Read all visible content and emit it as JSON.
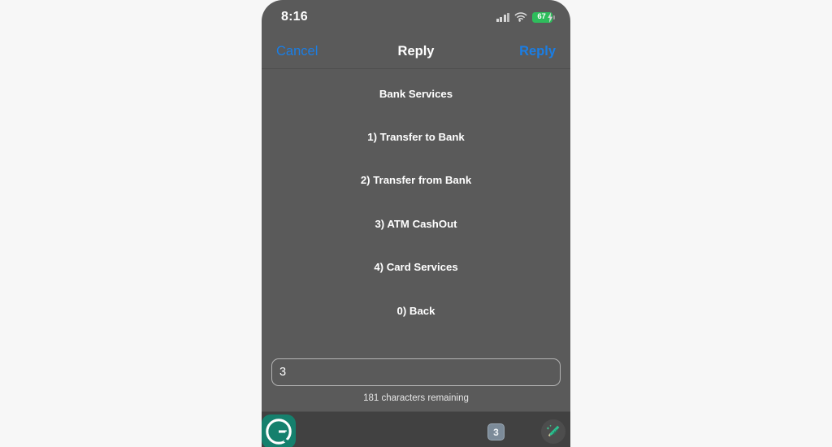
{
  "status_bar": {
    "time": "8:16",
    "signal_icon": "cellular-signal-icon",
    "wifi_icon": "wifi-icon",
    "battery_percent": "67",
    "battery_charging_icon": "charging-bolt-icon"
  },
  "nav_bar": {
    "cancel_label": "Cancel",
    "title": "Reply",
    "reply_label": "Reply"
  },
  "message": {
    "lines": [
      "Bank Services",
      "1) Transfer to Bank",
      "2) Transfer from Bank",
      "3) ATM CashOut",
      "4) Card Services",
      "0) Back"
    ]
  },
  "composer": {
    "input_value": "3",
    "input_placeholder": "",
    "char_count": "181 characters remaining"
  },
  "keyboard_bar": {
    "grammarly_logo_icon": "grammarly-logo-icon",
    "suggestion_badge": "3",
    "ai_rewrite_icon": "magic-pencil-icon"
  },
  "colors": {
    "accent_blue": "#1a7ee5",
    "body_background": "#5a5a5a",
    "toolbar_background": "#414141",
    "battery_green": "#2ebd5c",
    "grammarly_green": "#15806d"
  }
}
